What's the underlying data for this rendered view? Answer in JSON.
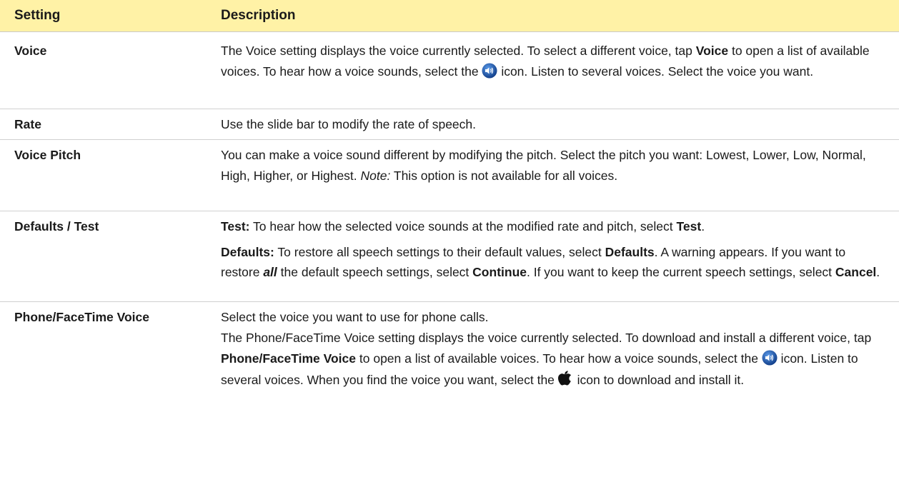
{
  "header": {
    "setting": "Setting",
    "description": "Description"
  },
  "rows": {
    "voice": {
      "setting": "Voice",
      "t1": "The Voice setting displays the voice currently selected. To select a different voice, tap ",
      "b1": "Voice",
      "t2": " to open a list of available voices. To hear how a voice sounds, select the ",
      "t3": " icon. Listen to several voices. Select the voice you want."
    },
    "rate": {
      "setting": "Rate",
      "text": "Use the slide bar to modify the rate of speech."
    },
    "pitch": {
      "setting": "Voice Pitch",
      "t1": "You can make a voice sound different by modifying the pitch. Select the pitch you want: Lowest, Lower, Low, Normal, High, Higher, or Highest. ",
      "note": "Note:",
      "t2": " This option is not available for all voices."
    },
    "defaults": {
      "setting": "Defaults / Test",
      "test_label": "Test:",
      "test_text": " To hear how the selected voice sounds at the modified rate and pitch, select ",
      "test_bold": "Test",
      "test_end": ".",
      "def_label": "Defaults:",
      "def_t1": " To restore all speech settings to their default values, select ",
      "def_b1": "Defaults",
      "def_t2": ". A warning appears. If you want to restore ",
      "def_all": "all",
      "def_t3": " the default speech settings, select ",
      "def_b2": "Continue",
      "def_t4": ". If you want to keep the current speech settings, select ",
      "def_b3": "Cancel",
      "def_t5": "."
    },
    "phone": {
      "setting": "Phone/FaceTime Voice",
      "line1": "Select the voice you want to use for phone calls.",
      "t1": "The Phone/FaceTime Voice setting displays the voice currently selected. To download and install a different voice, tap ",
      "b1": "Phone/FaceTime Voice",
      "t2": " to open a list of available voices. To hear how a voice sounds, select the ",
      "t3": " icon. Listen to several voices. When you find the voice you want, select the ",
      "t4": " icon to download and install it."
    }
  },
  "icons": {
    "speaker": "speaker-icon",
    "apple": "apple-icon"
  },
  "colors": {
    "header_bg": "#fff2a6",
    "speaker_blue": "#1f5fb8"
  }
}
